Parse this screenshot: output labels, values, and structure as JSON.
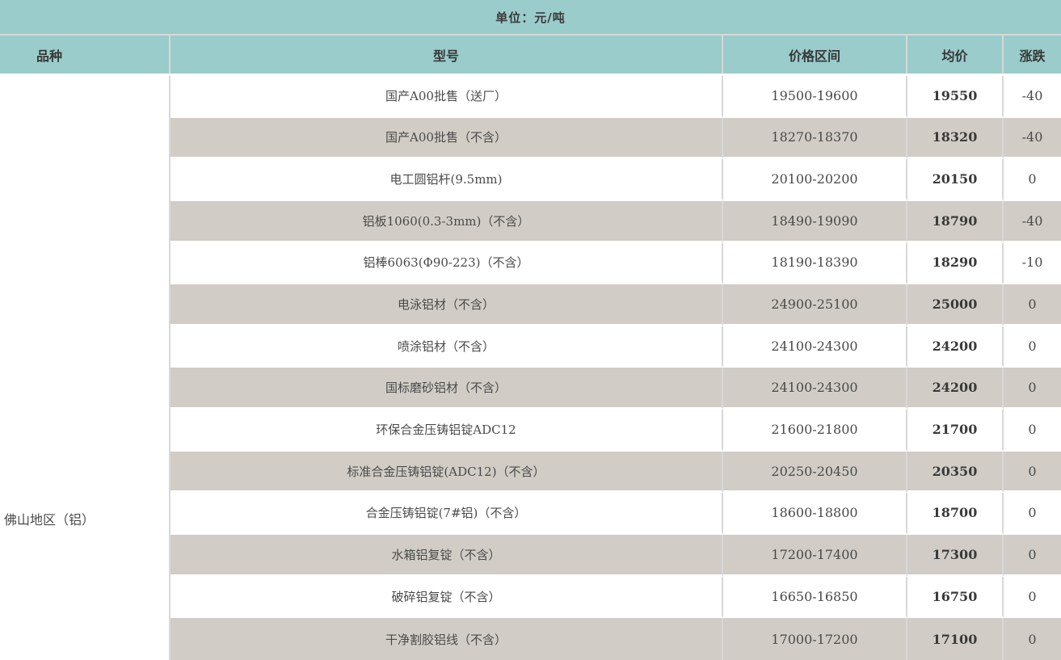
{
  "unit_label": "单位：元/吨",
  "header": {
    "variety": "品种",
    "model": "型号",
    "price_range": "价格区间",
    "avg_price": "均价",
    "change": "涨跌"
  },
  "region_label": "佛山地区（铝）",
  "rows": [
    {
      "model": "国产A00批售（送厂）",
      "range": "19500-19600",
      "avg": "19550",
      "change": "-40"
    },
    {
      "model": "国产A00批售（不含）",
      "range": "18270-18370",
      "avg": "18320",
      "change": "-40"
    },
    {
      "model": "电工圆铝杆(9.5mm)",
      "range": "20100-20200",
      "avg": "20150",
      "change": "0"
    },
    {
      "model": "铝板1060(0.3-3mm)（不含）",
      "range": "18490-19090",
      "avg": "18790",
      "change": "-40"
    },
    {
      "model": "铝棒6063(Φ90-223)（不含）",
      "range": "18190-18390",
      "avg": "18290",
      "change": "-10"
    },
    {
      "model": "电泳铝材（不含）",
      "range": "24900-25100",
      "avg": "25000",
      "change": "0"
    },
    {
      "model": "喷涂铝材（不含）",
      "range": "24100-24300",
      "avg": "24200",
      "change": "0"
    },
    {
      "model": "国标磨砂铝材（不含）",
      "range": "24100-24300",
      "avg": "24200",
      "change": "0"
    },
    {
      "model": "环保合金压铸铝锭ADC12",
      "range": "21600-21800",
      "avg": "21700",
      "change": "0"
    },
    {
      "model": "标准合金压铸铝锭(ADC12)（不含）",
      "range": "20250-20450",
      "avg": "20350",
      "change": "0"
    },
    {
      "model": "合金压铸铝锭(7#铝)（不含）",
      "range": "18600-18800",
      "avg": "18700",
      "change": "0"
    },
    {
      "model": "水箱铝复锭（不含）",
      "range": "17200-17400",
      "avg": "17300",
      "change": "0"
    },
    {
      "model": "破碎铝复锭（不含）",
      "range": "16650-16850",
      "avg": "16750",
      "change": "0"
    },
    {
      "model": "干净割胶铝线（不含）",
      "range": "17000-17200",
      "avg": "17100",
      "change": "0"
    }
  ],
  "colors": {
    "teal": "#99cccb",
    "row_alt": "#d1cdc6",
    "grid_line": "#d8d8d8"
  },
  "chart_data": {
    "type": "table",
    "title": "单位：元/吨",
    "columns": [
      "品种",
      "型号",
      "价格区间",
      "均价",
      "涨跌"
    ],
    "region": "佛山地区（铝）",
    "rows": [
      [
        "国产A00批售（送厂）",
        "19500-19600",
        19550,
        -40
      ],
      [
        "国产A00批售（不含）",
        "18270-18370",
        18320,
        -40
      ],
      [
        "电工圆铝杆(9.5mm)",
        "20100-20200",
        20150,
        0
      ],
      [
        "铝板1060(0.3-3mm)（不含）",
        "18490-19090",
        18790,
        -40
      ],
      [
        "铝棒6063(Φ90-223)（不含）",
        "18190-18390",
        18290,
        -10
      ],
      [
        "电泳铝材（不含）",
        "24900-25100",
        25000,
        0
      ],
      [
        "喷涂铝材（不含）",
        "24100-24300",
        24200,
        0
      ],
      [
        "国标磨砂铝材（不含）",
        "24100-24300",
        24200,
        0
      ],
      [
        "环保合金压铸铝锭ADC12",
        "21600-21800",
        21700,
        0
      ],
      [
        "标准合金压铸铝锭(ADC12)（不含）",
        "20250-20450",
        20350,
        0
      ],
      [
        "合金压铸铝锭(7#铝)（不含）",
        "18600-18800",
        18700,
        0
      ],
      [
        "水箱铝复锭（不含）",
        "17200-17400",
        17300,
        0
      ],
      [
        "破碎铝复锭（不含）",
        "16650-16850",
        16750,
        0
      ],
      [
        "干净割胶铝线（不含）",
        "17000-17200",
        17100,
        0
      ]
    ]
  }
}
